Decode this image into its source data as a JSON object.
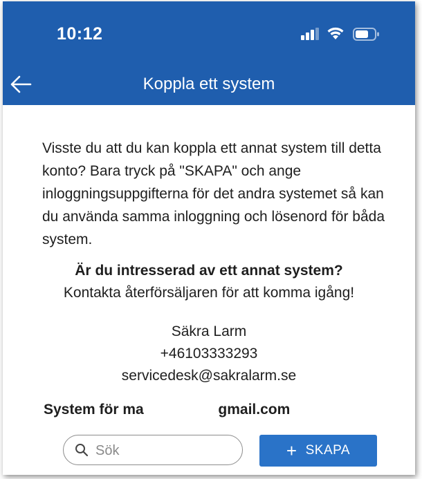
{
  "status_bar": {
    "time": "10:12",
    "icons": [
      "signal-icon",
      "wifi-icon",
      "battery-icon"
    ]
  },
  "header": {
    "title": "Koppla ett system",
    "back_icon": "arrow-left-icon"
  },
  "intro_text": "Visste du att du kan koppla ett annat system till detta konto? Bara tryck på \"SKAPA\" och ange inloggningsuppgifterna för det andra systemet så kan du använda samma inloggning och lösenord för båda system.",
  "question": "Är du intresserad av ett annat system?",
  "contact_hint": "Kontakta återförsäljaren för att komma igång!",
  "dealer": {
    "name": "Säkra Larm",
    "phone": "+46103333293",
    "email": "servicedesk@sakralarm.se"
  },
  "systems_heading": {
    "prefix": "System för ma",
    "suffix": "gmail.com"
  },
  "search": {
    "placeholder": "Sök",
    "value": ""
  },
  "create_button": {
    "label": "SKAPA"
  },
  "colors": {
    "header_bg": "#1f5eae",
    "button_bg": "#2a73c8",
    "text": "#1e1e1e"
  }
}
